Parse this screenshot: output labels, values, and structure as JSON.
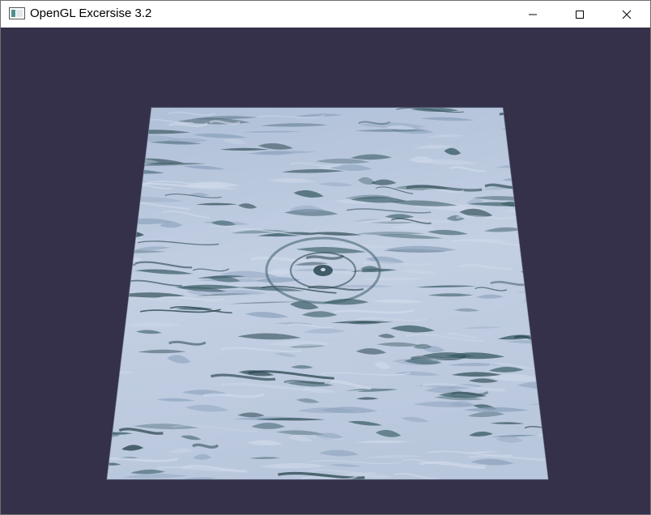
{
  "window": {
    "title": "OpenGL Excersise 3.2",
    "app_icon": "window-app-icon",
    "controls": {
      "minimize_icon": "minimize-icon",
      "maximize_icon": "maximize-icon",
      "close_icon": "close-icon"
    }
  },
  "scene": {
    "background_color": "#35314a",
    "plane_texture": "water-texture",
    "texture_colors": {
      "light": "#cfd9ea",
      "mid": "#8da3bd",
      "dark": "#3b5d67",
      "deep": "#2a4750"
    }
  }
}
